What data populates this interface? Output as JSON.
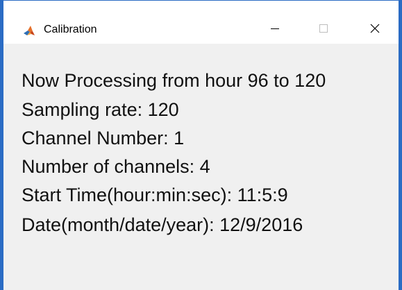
{
  "window": {
    "title": "Calibration",
    "app_icon": "matlab-icon",
    "controls": {
      "minimize_icon": "minimize-icon",
      "maximize_icon": "maximize-icon",
      "close_icon": "close-icon"
    },
    "accent_color": "#2b6cc4"
  },
  "content": {
    "lines": [
      "Now Processing from hour 96 to 120",
      "Sampling rate: 120",
      "Channel Number: 1",
      "Number of channels: 4",
      "Start Time(hour:min:sec): 11:5:9",
      "Date(month/date/year): 12/9/2016"
    ]
  }
}
